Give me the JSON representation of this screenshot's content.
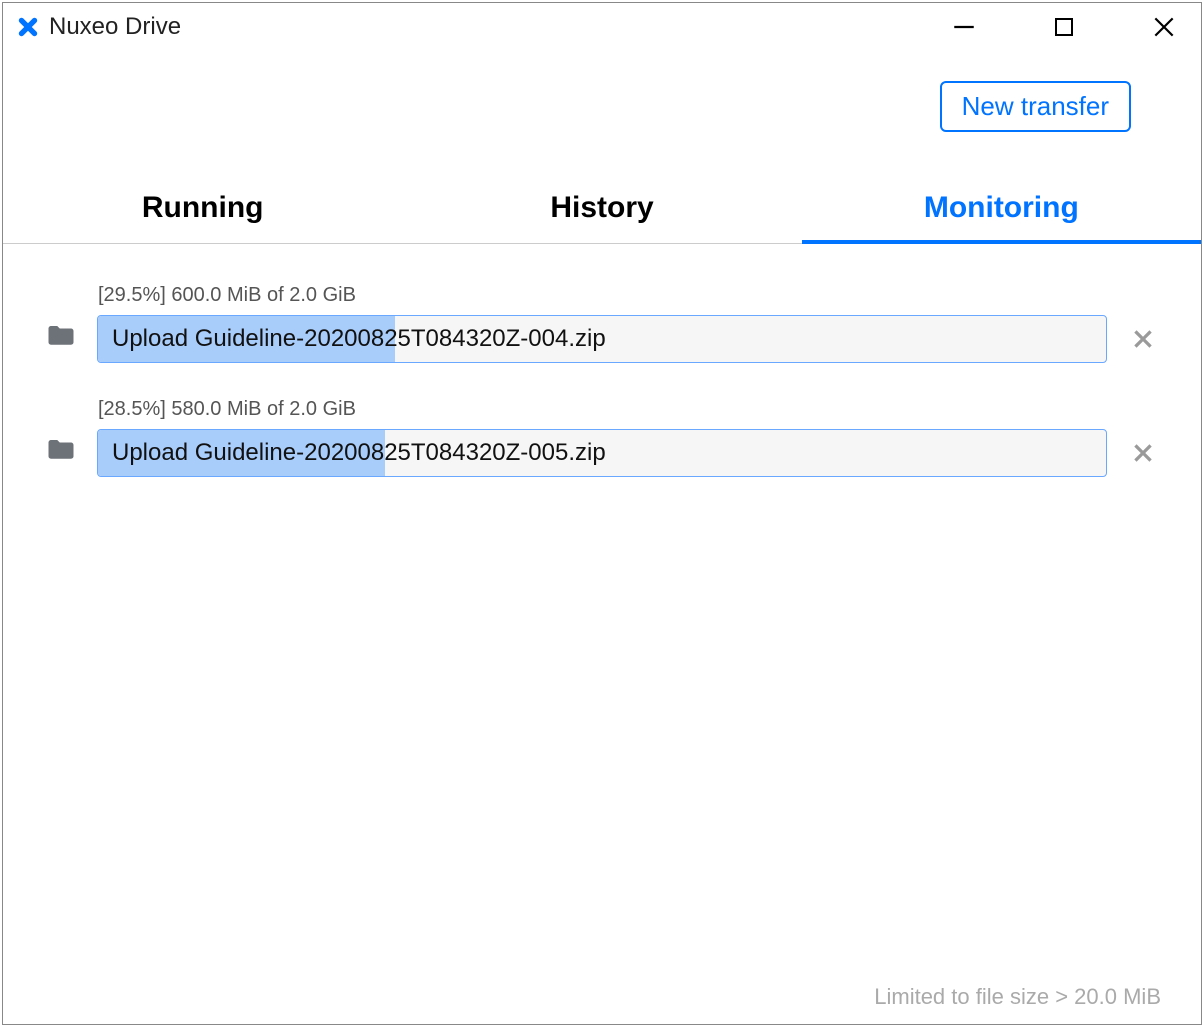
{
  "app": {
    "title": "Nuxeo Drive"
  },
  "toolbar": {
    "new_transfer_label": "New transfer"
  },
  "tabs": {
    "running": "Running",
    "history": "History",
    "monitoring": "Monitoring"
  },
  "transfers": [
    {
      "status": "[29.5%] 600.0 MiB of 2.0 GiB",
      "filename": "Upload Guideline-20200825T084320Z-004.zip",
      "percent": 29.5
    },
    {
      "status": "[28.5%] 580.0 MiB of 2.0 GiB",
      "filename": "Upload Guideline-20200825T084320Z-005.zip",
      "percent": 28.5
    }
  ],
  "footer": {
    "note": "Limited to file size > 20.0 MiB"
  },
  "colors": {
    "accent": "#0073ff",
    "progress_fill": "#a9cdfb",
    "progress_bg": "#f6f6f6"
  }
}
